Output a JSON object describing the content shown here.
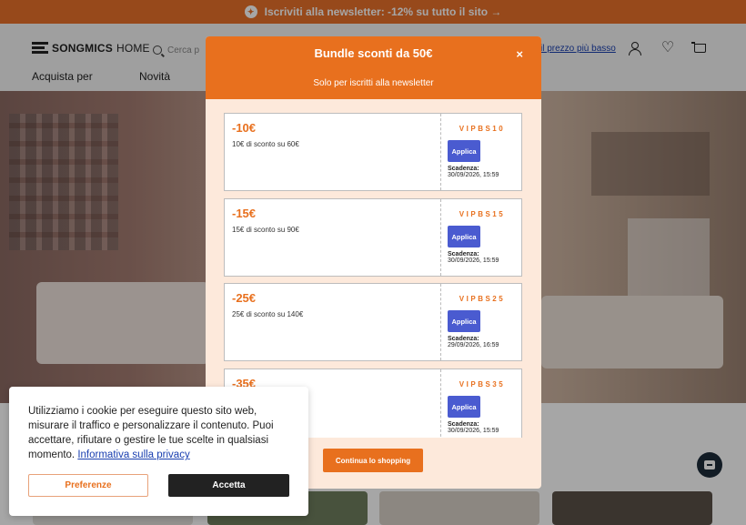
{
  "promo": {
    "text": "Iscriviti alla newsletter: -12% su tutto il sito →",
    "icon": "gift-icon"
  },
  "header": {
    "logo_bold": "SONGMICS",
    "logo_light": "HOME",
    "search_placeholder": "Cerca p",
    "price_link": "il prezzo più basso",
    "nav": [
      "Acquista per",
      "Novità"
    ]
  },
  "modal": {
    "title": "Bundle sconti da 50€",
    "close": "×",
    "subtitle": "Solo per iscritti alla newsletter",
    "coupons": [
      {
        "amount": "-10€",
        "desc": "10€ di sconto su 60€",
        "code": "VIPBS10",
        "apply": "Applica",
        "exp_label": "Scadenza:",
        "exp": "30/09/2026, 15:59"
      },
      {
        "amount": "-15€",
        "desc": "15€ di sconto su 90€",
        "code": "VIPBS15",
        "apply": "Applica",
        "exp_label": "Scadenza:",
        "exp": "30/09/2026, 15:59"
      },
      {
        "amount": "-25€",
        "desc": "25€ di sconto su 140€",
        "code": "VIPBS25",
        "apply": "Applica",
        "exp_label": "Scadenza:",
        "exp": "29/09/2026, 16:59"
      },
      {
        "amount": "-35€",
        "desc": "",
        "code": "VIPBS35",
        "apply": "Applica",
        "exp_label": "Scadenza:",
        "exp": "30/09/2026, 15:59"
      }
    ],
    "continue": "Continua lo shopping"
  },
  "cookie": {
    "text": "Utilizziamo i cookie per eseguire questo sito web, misurare il traffico e personalizzare il contenuto. Puoi accettare, rifiutare o gestire le tue scelte in qualsiasi momento.",
    "link": "Informativa sulla privacy",
    "preferences": "Preferenze",
    "accept": "Accetta"
  },
  "colors": {
    "accent": "#e8701e",
    "apply": "#4a5bd0",
    "dark": "#222222",
    "link": "#1a3fb0"
  }
}
